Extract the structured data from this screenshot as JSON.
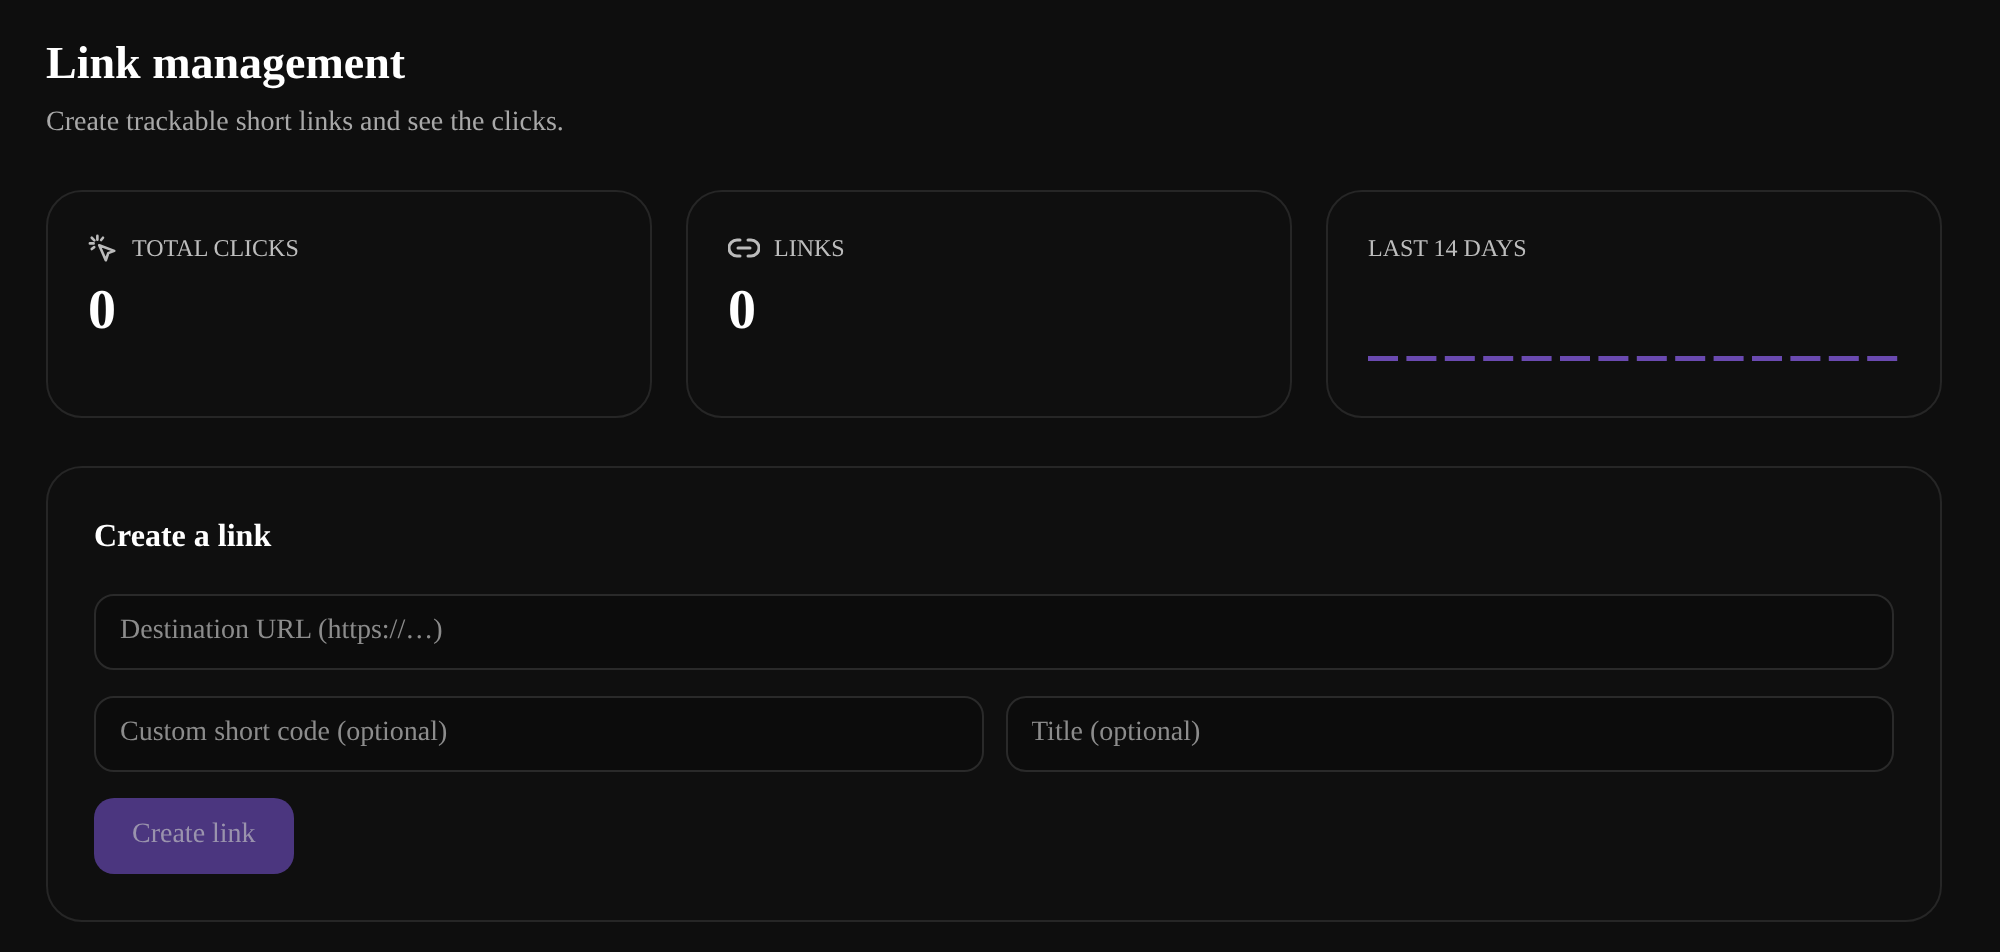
{
  "header": {
    "title": "Link management",
    "subtitle": "Create trackable short links and see the clicks."
  },
  "stats": [
    {
      "kind": "clicks",
      "label": "TOTAL CLICKS",
      "value": "0"
    },
    {
      "kind": "links",
      "label": "LINKS",
      "value": "0"
    },
    {
      "kind": "sparkline",
      "label": "LAST 14 DAYS"
    }
  ],
  "form": {
    "title": "Create a link",
    "fields": [
      {
        "placeholder": "Destination URL (https://…)"
      },
      {
        "placeholder": "Custom short code (optional)"
      },
      {
        "placeholder": "Title (optional)"
      }
    ],
    "button": {
      "label": "Create link",
      "disabled": true
    }
  }
}
